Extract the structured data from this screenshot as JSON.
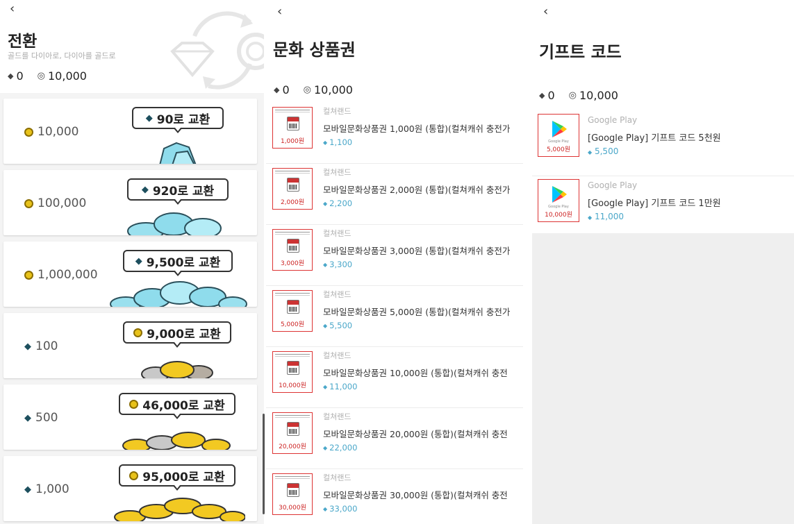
{
  "icons": {
    "back": "‹",
    "diamond": "◆",
    "gold": "◎"
  },
  "colors": {
    "accent_cost": "#4aa7c9",
    "price_red": "#c22",
    "gold": "#e8c21a"
  },
  "exchange": {
    "title": "전환",
    "subtitle": "골드를 다이아로, 다이아를 골드로",
    "balance": {
      "diamond": "0",
      "gold": "10,000"
    },
    "cards": [
      {
        "cost": "10,000",
        "cost_currency": "gold",
        "reward": "90로 교환",
        "reward_currency": "diamond"
      },
      {
        "cost": "100,000",
        "cost_currency": "gold",
        "reward": "920로 교환",
        "reward_currency": "diamond"
      },
      {
        "cost": "1,000,000",
        "cost_currency": "gold",
        "reward": "9,500로 교환",
        "reward_currency": "diamond"
      },
      {
        "cost": "100",
        "cost_currency": "diamond",
        "reward": "9,000로 교환",
        "reward_currency": "gold"
      },
      {
        "cost": "500",
        "cost_currency": "diamond",
        "reward": "46,000로 교환",
        "reward_currency": "gold"
      },
      {
        "cost": "1,000",
        "cost_currency": "diamond",
        "reward": "95,000로 교환",
        "reward_currency": "gold"
      }
    ]
  },
  "culture": {
    "title": "문화 상품권",
    "balance": {
      "diamond": "0",
      "gold": "10,000"
    },
    "items": [
      {
        "brand": "컬쳐랜드",
        "name": "모바일문화상품권 1,000원 (통합)(컬쳐캐쉬 충전가",
        "cost": "1,100",
        "thumb_price": "1,000원"
      },
      {
        "brand": "컬쳐랜드",
        "name": "모바일문화상품권 2,000원 (통합)(컬쳐캐쉬 충전가",
        "cost": "2,200",
        "thumb_price": "2,000원"
      },
      {
        "brand": "컬쳐랜드",
        "name": "모바일문화상품권 3,000원 (통합)(컬쳐캐쉬 충전가",
        "cost": "3,300",
        "thumb_price": "3,000원"
      },
      {
        "brand": "컬쳐랜드",
        "name": "모바일문화상품권 5,000원 (통합)(컬쳐캐쉬 충전가",
        "cost": "5,500",
        "thumb_price": "5,000원"
      },
      {
        "brand": "컬쳐랜드",
        "name": "모바일문화상품권 10,000원 (통합)(컬쳐캐쉬 충전",
        "cost": "11,000",
        "thumb_price": "10,000원"
      },
      {
        "brand": "컬쳐랜드",
        "name": "모바일문화상품권 20,000원 (통합)(컬쳐캐쉬 충전",
        "cost": "22,000",
        "thumb_price": "20,000원"
      },
      {
        "brand": "컬쳐랜드",
        "name": "모바일문화상품권 30,000원 (통합)(컬쳐캐쉬 충전",
        "cost": "33,000",
        "thumb_price": "30,000원"
      }
    ]
  },
  "gift": {
    "title": "기프트 코드",
    "balance": {
      "diamond": "0",
      "gold": "10,000"
    },
    "items": [
      {
        "brand": "Google Play",
        "name": "[Google Play] 기프트 코드 5천원",
        "cost": "5,500",
        "thumb_label": "Google Play",
        "thumb_price": "5,000원"
      },
      {
        "brand": "Google Play",
        "name": "[Google Play] 기프트 코드 1만원",
        "cost": "11,000",
        "thumb_label": "Google Play",
        "thumb_price": "10,000원"
      }
    ]
  }
}
